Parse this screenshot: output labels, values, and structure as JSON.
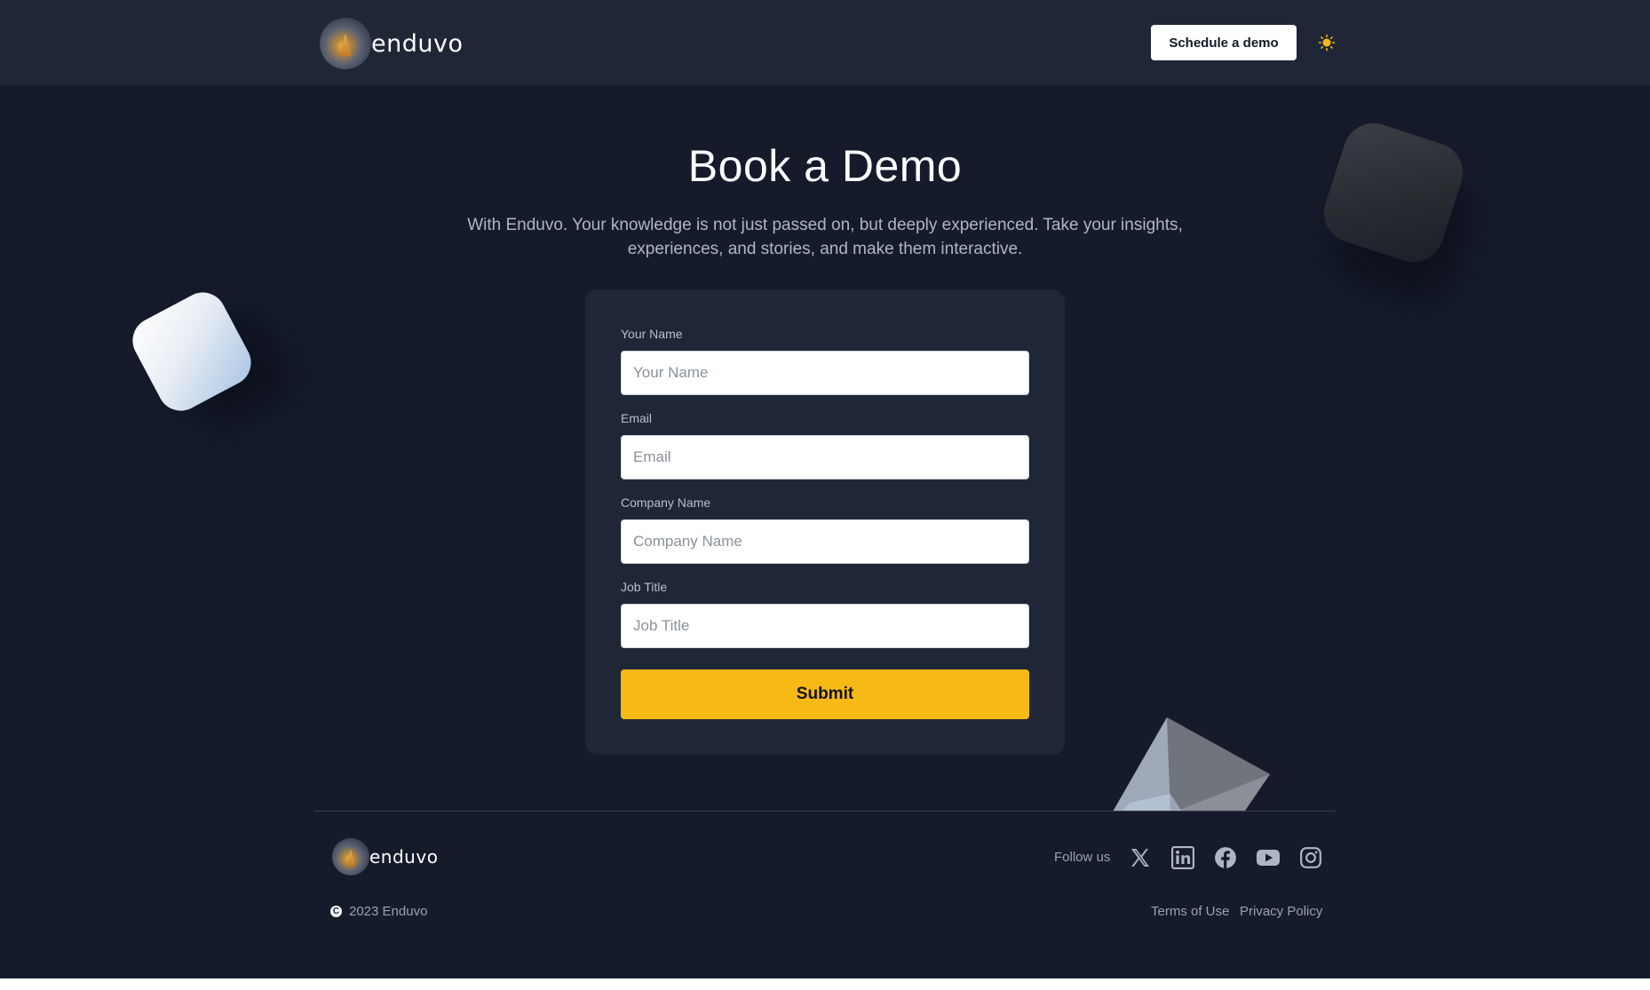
{
  "header": {
    "logo_text": "enduvo",
    "cta_label": "Schedule a demo",
    "theme_icon": "sun-icon"
  },
  "hero": {
    "title": "Book a Demo",
    "subtitle": "With Enduvo. Your knowledge is not just passed on, but deeply experienced. Take your insights, experiences, and stories, and make them interactive."
  },
  "form": {
    "fields": [
      {
        "label": "Your Name",
        "placeholder": "Your Name"
      },
      {
        "label": "Email",
        "placeholder": "Email"
      },
      {
        "label": "Company Name",
        "placeholder": "Company Name"
      },
      {
        "label": "Job Title",
        "placeholder": "Job Title"
      }
    ],
    "submit_label": "Submit"
  },
  "footer": {
    "logo_text": "enduvo",
    "follow_label": "Follow us",
    "social_icons": [
      "x-icon",
      "linkedin-icon",
      "facebook-icon",
      "youtube-icon",
      "instagram-icon"
    ],
    "copyright": "2023 Enduvo",
    "links": [
      "Terms of Use",
      "Privacy Policy"
    ]
  },
  "colors": {
    "page_bg": "#151b2b",
    "panel_bg": "#1f2737",
    "accent": "#f7b916",
    "muted_text": "#9aa2ae"
  }
}
